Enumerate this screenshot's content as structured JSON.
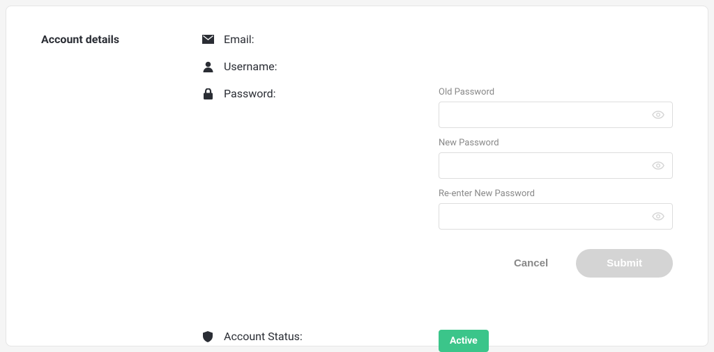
{
  "section_title": "Account details",
  "fields": {
    "email": {
      "label": "Email:",
      "value": ""
    },
    "username": {
      "label": "Username:",
      "value": ""
    },
    "password": {
      "label": "Password:",
      "old_label": "Old Password",
      "old_value": "",
      "new_label": "New Password",
      "new_value": "",
      "confirm_label": "Re-enter New Password",
      "confirm_value": ""
    },
    "account_status": {
      "label": "Account Status:",
      "value": "Active"
    }
  },
  "actions": {
    "cancel": "Cancel",
    "submit": "Submit"
  },
  "colors": {
    "badge_bg": "#3bc58a",
    "submit_bg": "#d4d4d4"
  }
}
